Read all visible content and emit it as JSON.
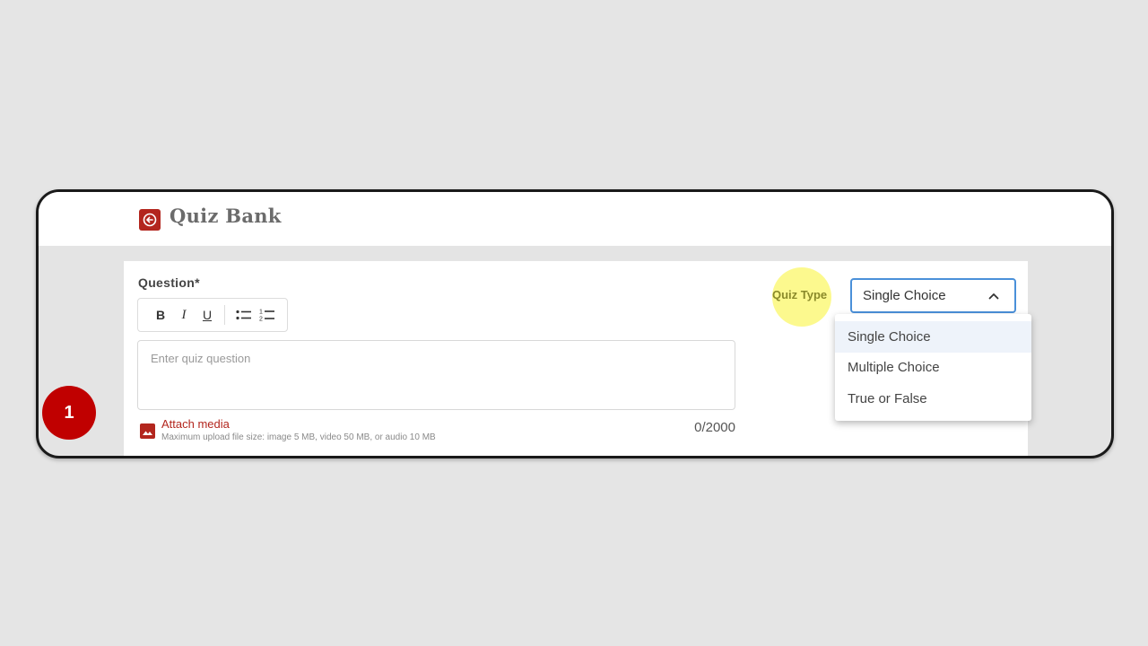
{
  "header": {
    "title": "Quiz Bank",
    "back_icon": "arrow-left-icon"
  },
  "question": {
    "label": "Question*",
    "toolbar": {
      "bold": "B",
      "italic": "I",
      "underline": "U",
      "bullet_list_icon": "bulleted-list-icon",
      "numbered_list_icon": "numbered-list-icon"
    },
    "placeholder": "Enter quiz question",
    "value": "",
    "char_count": "0/2000",
    "attach_label": "Attach media",
    "attach_help": "Maximum upload file size: image 5 MB, video 50 MB, or audio 10 MB"
  },
  "quiz_type": {
    "label": "Quiz Type",
    "selected": "Single Choice",
    "options": [
      "Single Choice",
      "Multiple Choice",
      "True or False"
    ]
  },
  "step_badge": "1",
  "colors": {
    "brand": "#b3261e",
    "focus": "#4a90d9",
    "highlight": "#fbf87a",
    "badge": "#c00000"
  }
}
